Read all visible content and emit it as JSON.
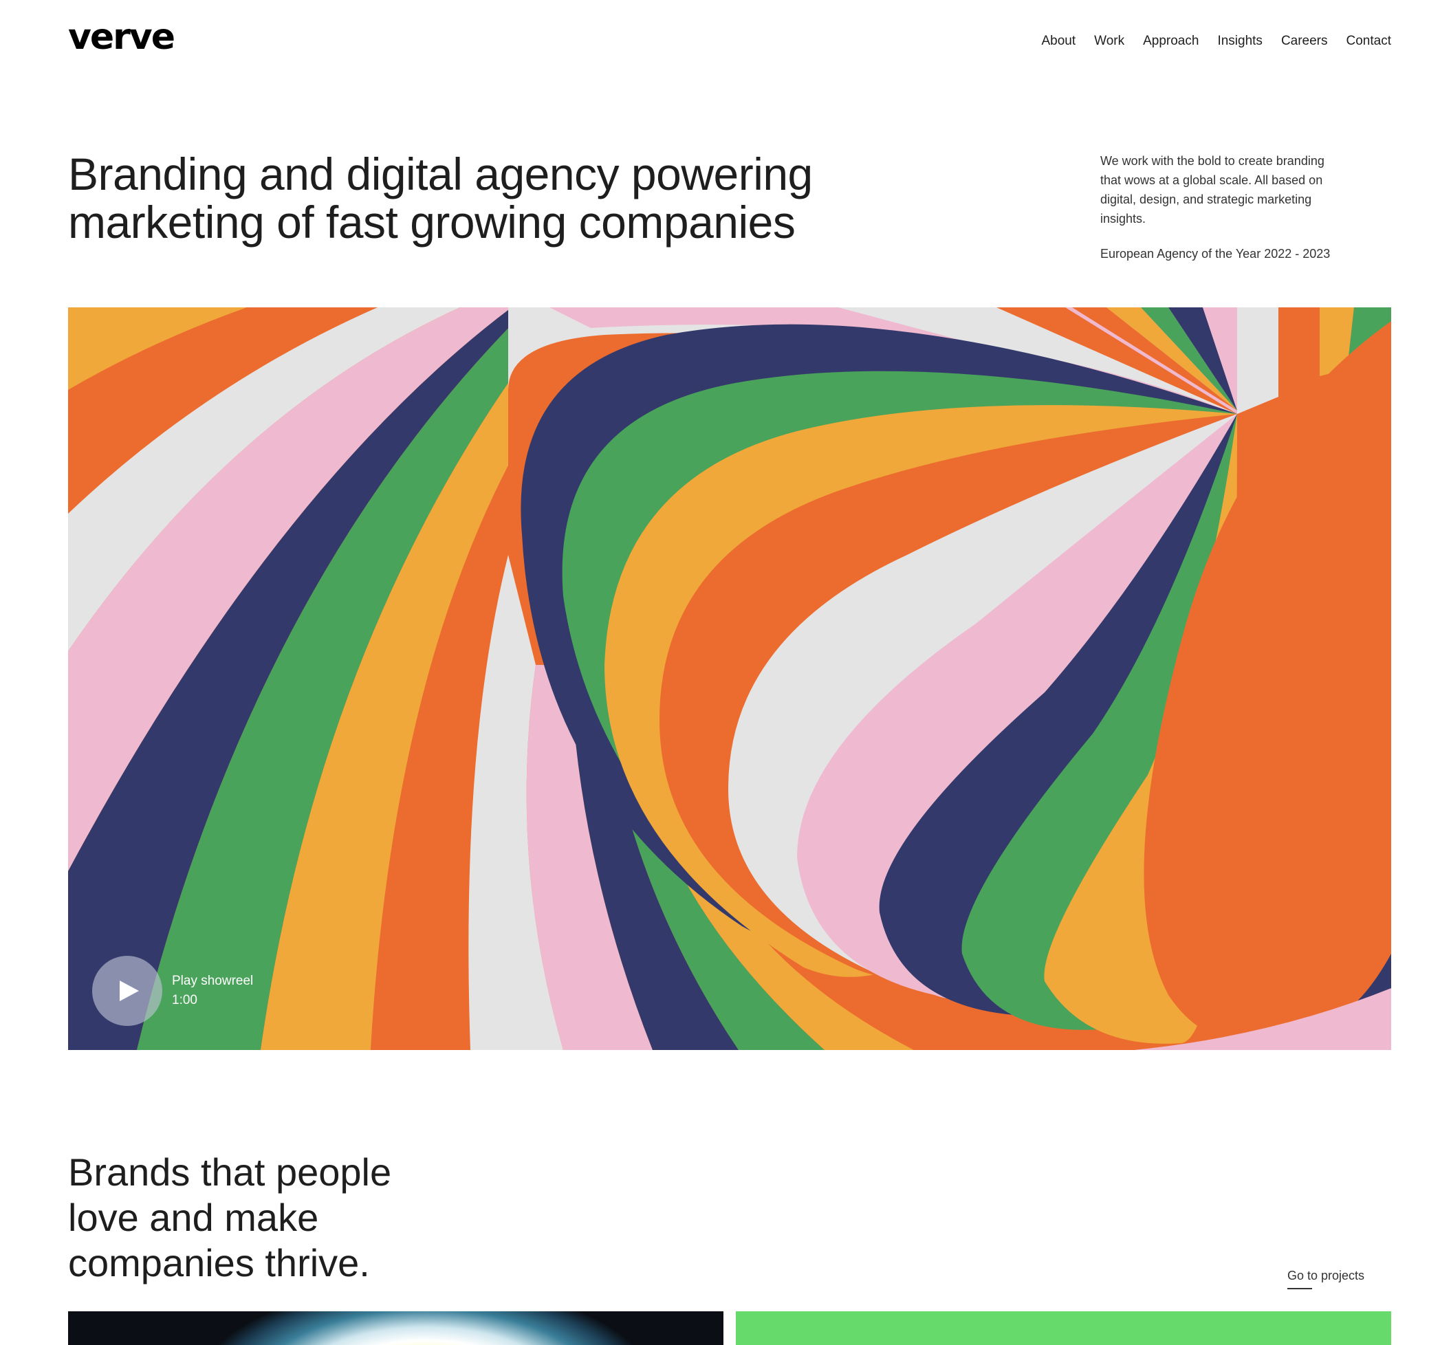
{
  "header": {
    "logo": "verve",
    "nav": [
      "About",
      "Work",
      "Approach",
      "Insights",
      "Careers",
      "Contact"
    ]
  },
  "hero": {
    "title": "Branding and digital agency powering marketing of fast growing companies",
    "description": "We work with the bold to create branding that wows at a global scale. All based on digital, design, and strategic marketing insights.",
    "award": "European Agency of the Year 2022 - 2023",
    "showreel": {
      "label": "Play showreel",
      "duration": "1:00"
    },
    "palette": [
      "#e4e4e4",
      "#efbad0",
      "#333a6b",
      "#4aa35a",
      "#f0a83a",
      "#ec6c2f"
    ]
  },
  "brands": {
    "title": "Brands that people love and make companies thrive.",
    "link": "Go to projects"
  },
  "projects": {
    "right_card_color": "#66da6a"
  }
}
